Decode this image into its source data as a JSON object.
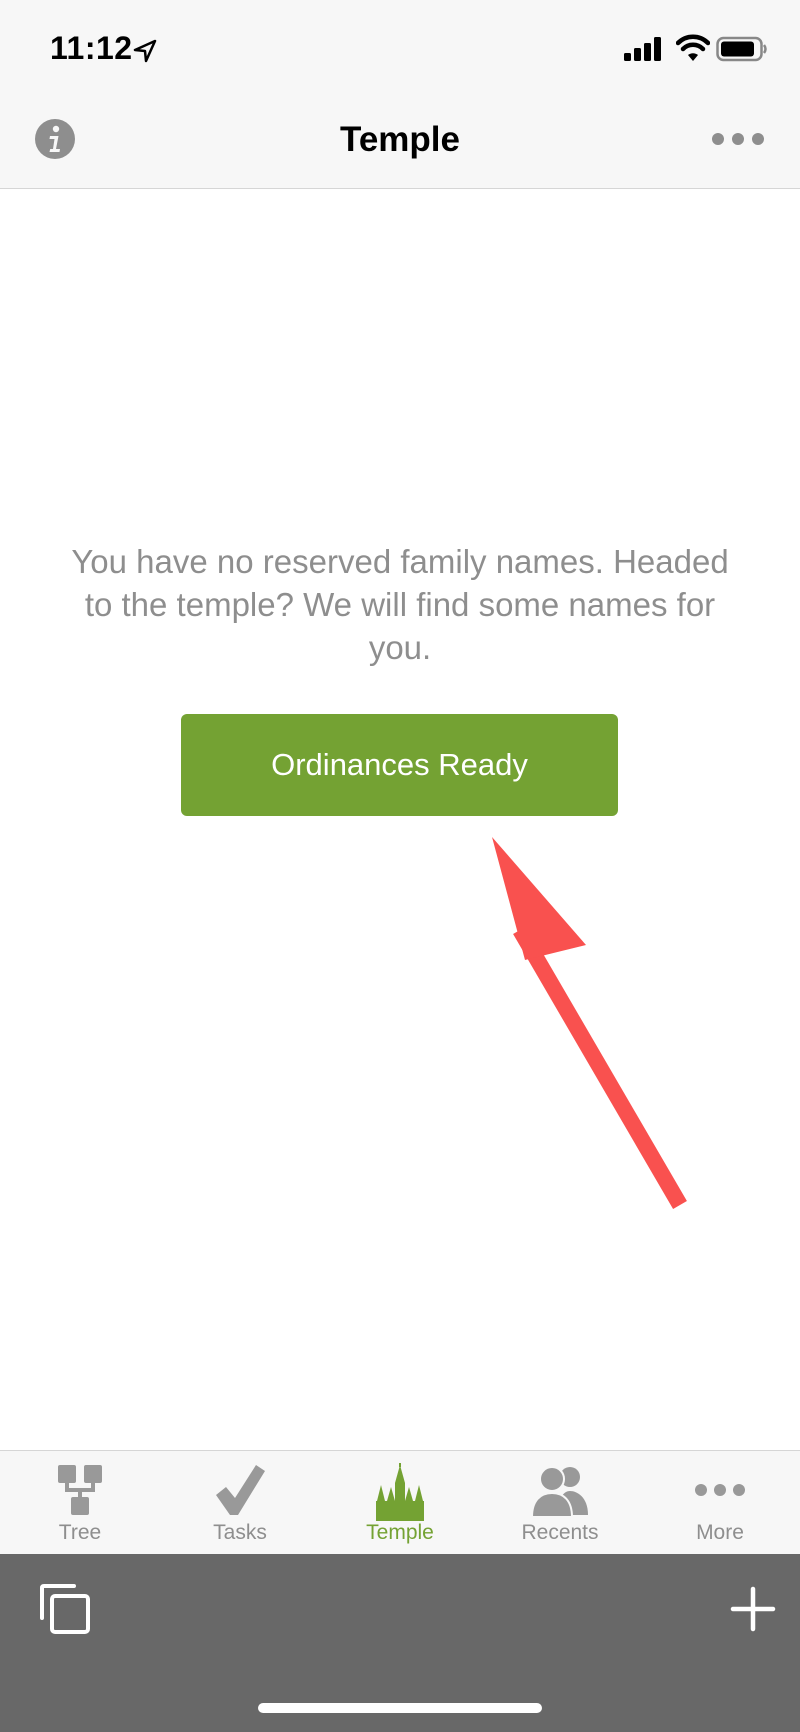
{
  "status_bar": {
    "time": "11:12",
    "location_icon": "location-arrow-icon",
    "signal_icon": "cellular-signal-icon",
    "wifi_icon": "wifi-icon",
    "battery_icon": "battery-icon"
  },
  "nav": {
    "title": "Temple",
    "left_icon": "info-icon",
    "right_icon": "more-dots-icon"
  },
  "main": {
    "message": "You have no reserved family names. Headed to the temple? We will find some names for you.",
    "button_label": "Ordinances Ready",
    "annotation": "red-arrow-pointing-at-button"
  },
  "tabs": [
    {
      "label": "Tree",
      "icon": "tree-icon",
      "active": false
    },
    {
      "label": "Tasks",
      "icon": "checkmark-icon",
      "active": false
    },
    {
      "label": "Temple",
      "icon": "temple-icon",
      "active": true
    },
    {
      "label": "Recents",
      "icon": "people-icon",
      "active": false
    },
    {
      "label": "More",
      "icon": "more-dots-icon",
      "active": false
    }
  ],
  "toolbar": {
    "left_icon": "copy-windows-icon",
    "right_icon": "plus-icon"
  },
  "colors": {
    "accent": "#74a233",
    "bar_background": "#f7f7f7",
    "toolbar_background": "#686868",
    "annotation_arrow": "#f9514f",
    "icon_gray": "#999999",
    "text_gray": "#8e8e8e"
  }
}
